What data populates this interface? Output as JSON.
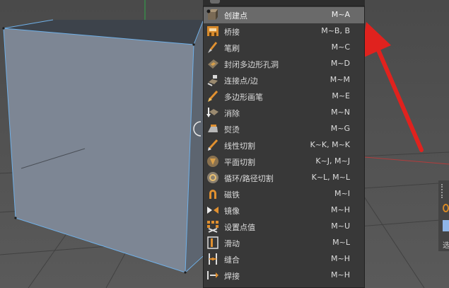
{
  "menu": {
    "items": [
      {
        "label": "创建点",
        "shortcut": "M~A",
        "icon": "create-point-icon",
        "highlighted": true
      },
      {
        "label": "桥接",
        "shortcut": "M~B, B",
        "icon": "bridge-icon"
      },
      {
        "label": "笔刷",
        "shortcut": "M~C",
        "icon": "brush-icon"
      },
      {
        "label": "封闭多边形孔洞",
        "shortcut": "M~D",
        "icon": "close-polygon-hole-icon"
      },
      {
        "label": "连接点/边",
        "shortcut": "M~M",
        "icon": "connect-points-edges-icon"
      },
      {
        "label": "多边形画笔",
        "shortcut": "M~E",
        "icon": "polygon-pen-icon"
      },
      {
        "label": "消除",
        "shortcut": "M~N",
        "icon": "dissolve-icon"
      },
      {
        "label": "熨烫",
        "shortcut": "M~G",
        "icon": "iron-icon"
      },
      {
        "label": "线性切割",
        "shortcut": "K~K, M~K",
        "icon": "line-cut-icon"
      },
      {
        "label": "平面切割",
        "shortcut": "K~J, M~J",
        "icon": "plane-cut-icon"
      },
      {
        "label": "循环/路径切割",
        "shortcut": "K~L, M~L",
        "icon": "loop-path-cut-icon"
      },
      {
        "label": "磁铁",
        "shortcut": "M~I",
        "icon": "magnet-icon"
      },
      {
        "label": "镜像",
        "shortcut": "M~H",
        "icon": "mirror-icon"
      },
      {
        "label": "设置点值",
        "shortcut": "M~U",
        "icon": "set-point-value-icon"
      },
      {
        "label": "滑动",
        "shortcut": "M~L",
        "icon": "slide-icon"
      },
      {
        "label": "缝合",
        "shortcut": "M~H",
        "icon": "stitch-icon"
      },
      {
        "label": "焊接",
        "shortcut": "M~H",
        "icon": "weld-icon"
      }
    ]
  },
  "side_panel": {
    "label": "选"
  },
  "colors": {
    "highlight": "#6a6a6a",
    "menu_bg": "#383838",
    "arrow": "#e0221e",
    "edge": "#6fb0e8"
  }
}
